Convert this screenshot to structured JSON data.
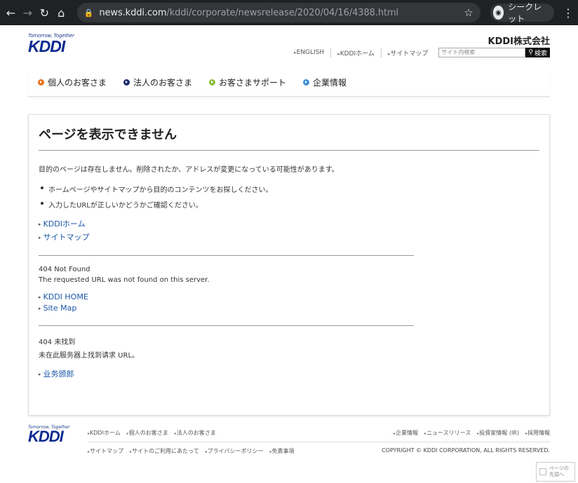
{
  "browser": {
    "url_domain": "news.kddi.com",
    "url_path": "/kddi/corporate/newsrelease/2020/04/16/4388.html",
    "incognito_label": "シークレット"
  },
  "header": {
    "logo_tagline": "Tomorrow, Together",
    "logo_text": "KDDI",
    "company_name": "KDDI株式会社",
    "util_links": [
      "ENGLISH",
      "KDDIホーム",
      "サイトマップ"
    ],
    "search_placeholder": "サイト内検索",
    "search_button": "検索"
  },
  "gnav": {
    "items": [
      {
        "label": "個人のお客さま",
        "color": "#e8731a"
      },
      {
        "label": "法人のお客さま",
        "color": "#1b2a6e"
      },
      {
        "label": "お客さまサポート",
        "color": "#8cbf3f"
      },
      {
        "label": "企業情報",
        "color": "#3d8fd6"
      }
    ]
  },
  "main": {
    "title": "ページを表示できません",
    "intro": "目的のページは存在しません。削除されたか、アドレスが変更になっている可能性があります。",
    "bullets": [
      "ホームページやサイトマップから目的のコンテンツをお探しください。",
      "入力したURLが正しいかどうかご確認ください。"
    ],
    "links_ja": [
      "KDDIホーム",
      "サイトマップ"
    ],
    "en_title": "404 Not Found",
    "en_message": "The requested URL was not found on this server.",
    "links_en": [
      "KDDI HOME",
      "Site Map"
    ],
    "zh_title": "404 未找到",
    "zh_message": "未在此服务器上找到请求 URL。",
    "links_zh": [
      "业务颁郎"
    ]
  },
  "footer": {
    "logo_tagline": "Tomorrow, Together",
    "logo_text": "KDDI",
    "row1": [
      "KDDIホーム",
      "個人のお客さま",
      "法人のお客さま"
    ],
    "row2": [
      "サイトマップ",
      "サイトのご利用にあたって",
      "プライバシーポリシー",
      "免責事項"
    ],
    "row3": [
      "企業情報",
      "ニュースリリース",
      "投資家情報 (IR)",
      "採用情報"
    ],
    "copyright": "COPYRIGHT © KDDI CORPORATION, ALL RIGHTS RESERVED."
  },
  "page_top": {
    "label_line1": "ページの",
    "label_line2": "先頭へ"
  }
}
